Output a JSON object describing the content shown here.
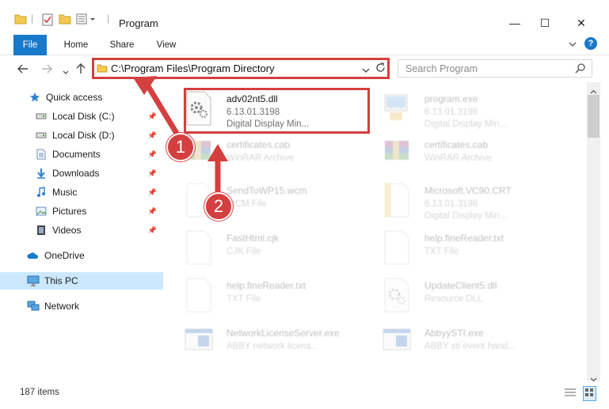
{
  "window": {
    "title": "Program",
    "min_glyph": "—",
    "max_glyph": "☐",
    "close_glyph": "✕"
  },
  "ribbon": {
    "tabs": [
      "File",
      "Home",
      "Share",
      "View"
    ],
    "help_glyph": "?"
  },
  "address": {
    "path": "C:\\Program Files\\Program Directory"
  },
  "search": {
    "placeholder": "Search Program"
  },
  "sidebar": {
    "items": [
      {
        "label": "Quick access",
        "icon": "star-icon"
      },
      {
        "label": "Local Disk (C:)",
        "icon": "drive-icon",
        "pinned": true
      },
      {
        "label": "Local Disk (D:)",
        "icon": "drive-icon",
        "pinned": true
      },
      {
        "label": "Documents",
        "icon": "documents-icon",
        "pinned": true
      },
      {
        "label": "Downloads",
        "icon": "downloads-icon",
        "pinned": true
      },
      {
        "label": "Music",
        "icon": "music-icon",
        "pinned": true
      },
      {
        "label": "Pictures",
        "icon": "pictures-icon",
        "pinned": true
      },
      {
        "label": "Videos",
        "icon": "videos-icon",
        "pinned": true
      },
      {
        "label": "OneDrive",
        "icon": "onedrive-icon"
      },
      {
        "label": "This PC",
        "icon": "this-pc-icon",
        "selected": true
      },
      {
        "label": "Network",
        "icon": "network-icon"
      }
    ]
  },
  "files": [
    {
      "name": "adv02nt5.dll",
      "line2": "6.13.01.3198",
      "line3": "Digital Display Min...",
      "icon": "dll-gear-icon",
      "highlighted": true
    },
    {
      "name": "program.exe",
      "line2": "6.13.01.3198",
      "line3": "Digital Display Min...",
      "icon": "exe-icon"
    },
    {
      "name": "certificates.cab",
      "line2": "WinRAR Archive",
      "line3": "",
      "icon": "winrar-icon"
    },
    {
      "name": "certificates.cab",
      "line2": "WinRAR Archive",
      "line3": "",
      "icon": "winrar-icon"
    },
    {
      "name": "SendToWP15.wcm",
      "line2": "WCM File",
      "line3": "",
      "icon": "blank-file-icon"
    },
    {
      "name": "Microsoft.VC90.CRT",
      "line2": "6.13.01.3198",
      "line3": "Digital Display Min...",
      "icon": "folder-file-icon"
    },
    {
      "name": "FastHtml.cjk",
      "line2": "CJK File",
      "line3": "",
      "icon": "blank-file-icon"
    },
    {
      "name": "help.fineReader.txt",
      "line2": "TXT File",
      "line3": "",
      "icon": "blank-file-icon"
    },
    {
      "name": "help.fineReader.txt",
      "line2": "TXT File",
      "line3": "",
      "icon": "blank-file-icon"
    },
    {
      "name": "UpdateClient5.dll",
      "line2": "Resource DLL",
      "line3": "",
      "icon": "dll-gear-icon"
    },
    {
      "name": "NetworkLicenseServer.exe",
      "line2": "ABBY network licens...",
      "line3": "",
      "icon": "exe-window-icon"
    },
    {
      "name": "AbbyySTI.exe",
      "line2": "ABBY sti event hand...",
      "line3": "",
      "icon": "exe-window-icon"
    }
  ],
  "annotations": {
    "badge1": "1",
    "badge2": "2"
  },
  "status": {
    "item_count": "187 items"
  },
  "colors": {
    "accent": "#1979ca",
    "highlight": "#d43f3f",
    "selected": "#cce8ff"
  }
}
